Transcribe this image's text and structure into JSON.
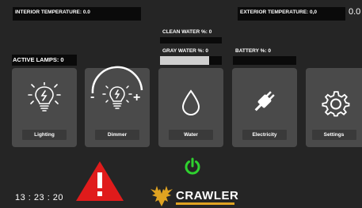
{
  "header": {
    "interior_temperature": "INTERIOR TEMPERATURE: 0.0",
    "exterior_temperature": "EXTERIOR TEMPERATURE: 0,0",
    "exterior_value": "0.0"
  },
  "levels": {
    "clean_water": "CLEAN WATER %: 0",
    "gray_water": "GRAY WATER %: 0",
    "battery": "BATTERY %: 0"
  },
  "active_lamps": "ACTIVE LAMPS: 0",
  "tiles": [
    {
      "label": "Lighting",
      "icon": "lightbulb-icon"
    },
    {
      "label": "Dimmer",
      "icon": "dimmer-icon"
    },
    {
      "label": "Water",
      "icon": "water-drop-icon"
    },
    {
      "label": "Electricity",
      "icon": "plug-icon"
    },
    {
      "label": "Settings",
      "icon": "gear-icon"
    }
  ],
  "dimmer": {
    "minus": "-",
    "plus": "+"
  },
  "clock": "13 : 23 : 20",
  "brand": {
    "name": "CRAWLER"
  },
  "colors": {
    "background": "#252525",
    "tile": "#4a4a4a",
    "warning_red": "#e01b1b",
    "power_green": "#2fd12f"
  }
}
